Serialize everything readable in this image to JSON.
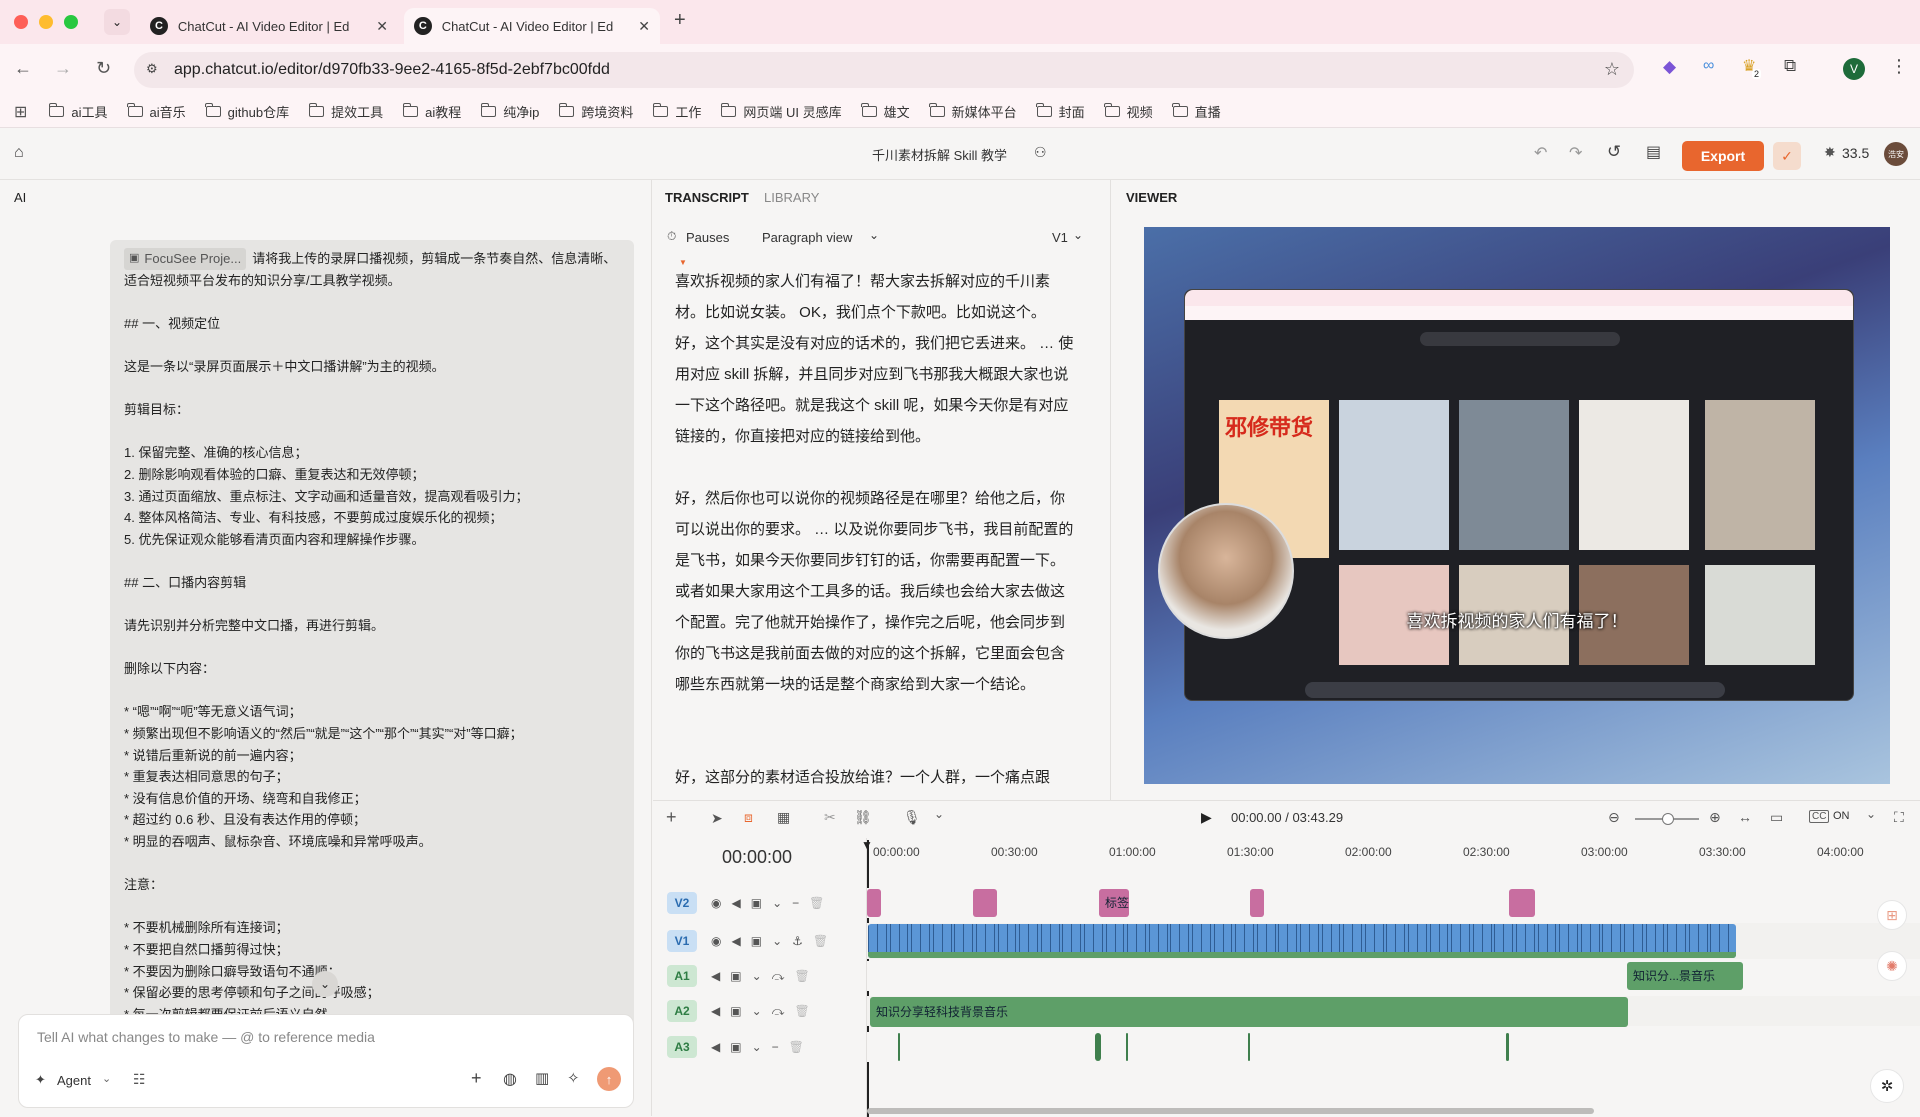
{
  "browser": {
    "tabs": [
      {
        "title": "ChatCut - AI Video Editor | Ed"
      },
      {
        "title": "ChatCut - AI Video Editor | Ed"
      }
    ],
    "url": "app.chatcut.io/editor/d970fb33-9ee2-4165-8f5d-2ebf7bc00fdd",
    "profile_initial": "V",
    "extension_badge": "2",
    "bookmarks": [
      "ai工具",
      "ai音乐",
      "github仓库",
      "提效工具",
      "ai教程",
      "纯净ip",
      "跨境资料",
      "工作",
      "网页端 UI 灵感库",
      "雄文",
      "新媒体平台",
      "封面",
      "视频",
      "直播"
    ]
  },
  "app": {
    "project_title": "千川素材拆解 Skill 教学",
    "export_label": "Export",
    "credits": "33.5",
    "avatar_text": "浩安"
  },
  "ai_panel": {
    "header": "AI",
    "attachment_chip": "FocuSee Proje...",
    "message": "请将我上传的录屏口播视频，剪辑成一条节奏自然、信息清晰、适合短视频平台发布的知识分享/工具教学视频。\n\n## 一、视频定位\n\n这是一条以“录屏页面展示＋中文口播讲解”为主的视频。\n\n剪辑目标：\n\n1. 保留完整、准确的核心信息；\n2. 删除影响观看体验的口癖、重复表达和无效停顿；\n3. 通过页面缩放、重点标注、文字动画和适量音效，提高观看吸引力；\n4. 整体风格简洁、专业、有科技感，不要剪成过度娱乐化的视频；\n5. 优先保证观众能够看清页面内容和理解操作步骤。\n\n## 二、口播内容剪辑\n\n请先识别并分析完整中文口播，再进行剪辑。\n\n删除以下内容：\n\n* “嗯”“啊”“呃”等无意义语气词；\n* 频繁出现但不影响语义的“然后”“就是”“这个”“那个”“其实”“对”等口癖；\n* 说错后重新说的前一遍内容；\n* 重复表达相同意思的句子；\n* 没有信息价值的开场、绕弯和自我修正；\n* 超过约 0.6 秒、且没有表达作用的停顿；\n* 明显的吞咽声、鼠标杂音、环境底噪和异常呼吸声。\n\n注意：\n\n* 不要机械删除所有连接词；\n* 不要把自然口播剪得过快；\n* 不要因为删除口癖导致语句不通顺；\n* 保留必要的思考停顿和句子之间的呼吸感；\n* 每一次剪辑都要保证前后语义自然",
    "input_placeholder": "Tell AI what changes to make — @ to reference media",
    "agent_label": "Agent"
  },
  "transcript_panel": {
    "tabs": [
      "TRANSCRIPT",
      "LIBRARY"
    ],
    "pauses_label": "Pauses",
    "view_mode": "Paragraph view",
    "version": "V1",
    "paragraphs": [
      "喜欢拆视频的家人们有福了！帮大家去拆解对应的千川素材。比如说女装。 OK，我们点个下款吧。比如说这个。 好，这个其实是没有对应的话术的，我们把它丢进来。 … 使用对应 skill 拆解，并且同步对应到飞书那我大概跟大家也说一下这个路径吧。就是我这个 skill 呢，如果今天你是有对应链接的，你直接把对应的链接给到他。",
      "好，然后你也可以说你的视频路径是在哪里？给他之后，你可以说出你的要求。 … 以及说你要同步飞书，我目前配置的是飞书，如果今天你要同步钉钉的话，你需要再配置一下。或者如果大家用这个工具多的话。我后续也会给大家去做这个配置。完了他就开始操作了，操作完之后呢，他会同步到你的飞书这是我前面去做的对应的这个拆解，它里面会包含哪些东西就第一块的话是整个商家给到大家一个结论。",
      "好，这部分的素材适合投放给谁？一个人群，一个痛点跟"
    ]
  },
  "viewer": {
    "header": "VIEWER",
    "subtitle": "喜欢拆视频的家人们有福了！",
    "banner_text": "邪修带货"
  },
  "timeline": {
    "current_time": "00:00.00",
    "total_time": "03:43.29",
    "playhead": "00:00:00",
    "cc_label": "ON",
    "ruler": [
      "00:00:00",
      "00:30:00",
      "01:00:00",
      "01:30:00",
      "02:00:00",
      "02:30:00",
      "03:00:00",
      "03:30:00",
      "04:00:00"
    ],
    "tracks": [
      {
        "id": "V2",
        "clip_label": "标签"
      },
      {
        "id": "V1"
      },
      {
        "id": "A1",
        "clip_label": "知识分...景音乐"
      },
      {
        "id": "A2",
        "clip_label": "知识分享轻科技背景音乐"
      },
      {
        "id": "A3"
      }
    ]
  },
  "colors": {
    "accent": "#e8662e",
    "video_track": "#5b96d6",
    "audio_track": "#5e9f68",
    "v2_clip": "#c86ea0",
    "badge_video_bg": "#c9dff4",
    "badge_audio_bg": "#cde7d2"
  }
}
